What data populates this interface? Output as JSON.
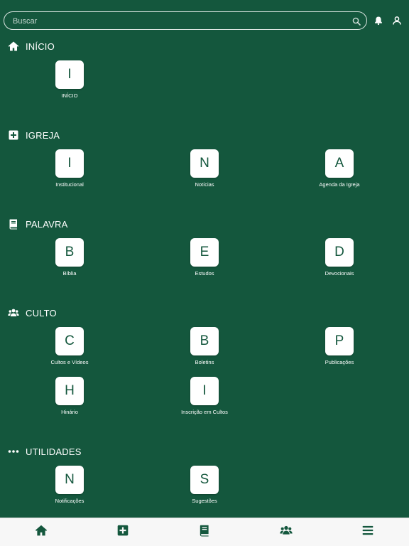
{
  "search": {
    "placeholder": "Buscar"
  },
  "colors": {
    "background": "#14573d",
    "tile": "#ffffff",
    "tile_letter": "#14573d",
    "tabbar": "#f7f7f7"
  },
  "sections": [
    {
      "title": "INÍCIO",
      "icon": "home-icon",
      "items": [
        {
          "letter": "I",
          "label": "INÍCIO"
        }
      ]
    },
    {
      "title": "IGREJA",
      "icon": "plus-square-icon",
      "items": [
        {
          "letter": "I",
          "label": "Institucional"
        },
        {
          "letter": "N",
          "label": "Notícias"
        },
        {
          "letter": "A",
          "label": "Agenda da Igreja"
        }
      ]
    },
    {
      "title": "PALAVRA",
      "icon": "book-icon",
      "items": [
        {
          "letter": "B",
          "label": "Bíblia"
        },
        {
          "letter": "E",
          "label": "Estudos"
        },
        {
          "letter": "D",
          "label": "Devocionais"
        }
      ]
    },
    {
      "title": "CULTO",
      "icon": "users-icon",
      "items": [
        {
          "letter": "C",
          "label": "Cultos e Vídeos"
        },
        {
          "letter": "B",
          "label": "Boletins"
        },
        {
          "letter": "P",
          "label": "Publicações"
        },
        {
          "letter": "H",
          "label": "Hinário"
        },
        {
          "letter": "I",
          "label": "Inscrição em Cultos"
        }
      ]
    },
    {
      "title": "UTILIDADES",
      "icon": "ellipsis-icon",
      "items": [
        {
          "letter": "N",
          "label": "Notificações"
        },
        {
          "letter": "S",
          "label": "Sugestões"
        }
      ]
    }
  ],
  "tabbar": [
    {
      "icon": "home-icon"
    },
    {
      "icon": "plus-square-icon"
    },
    {
      "icon": "book-icon"
    },
    {
      "icon": "users-icon"
    },
    {
      "icon": "menu-icon"
    }
  ]
}
